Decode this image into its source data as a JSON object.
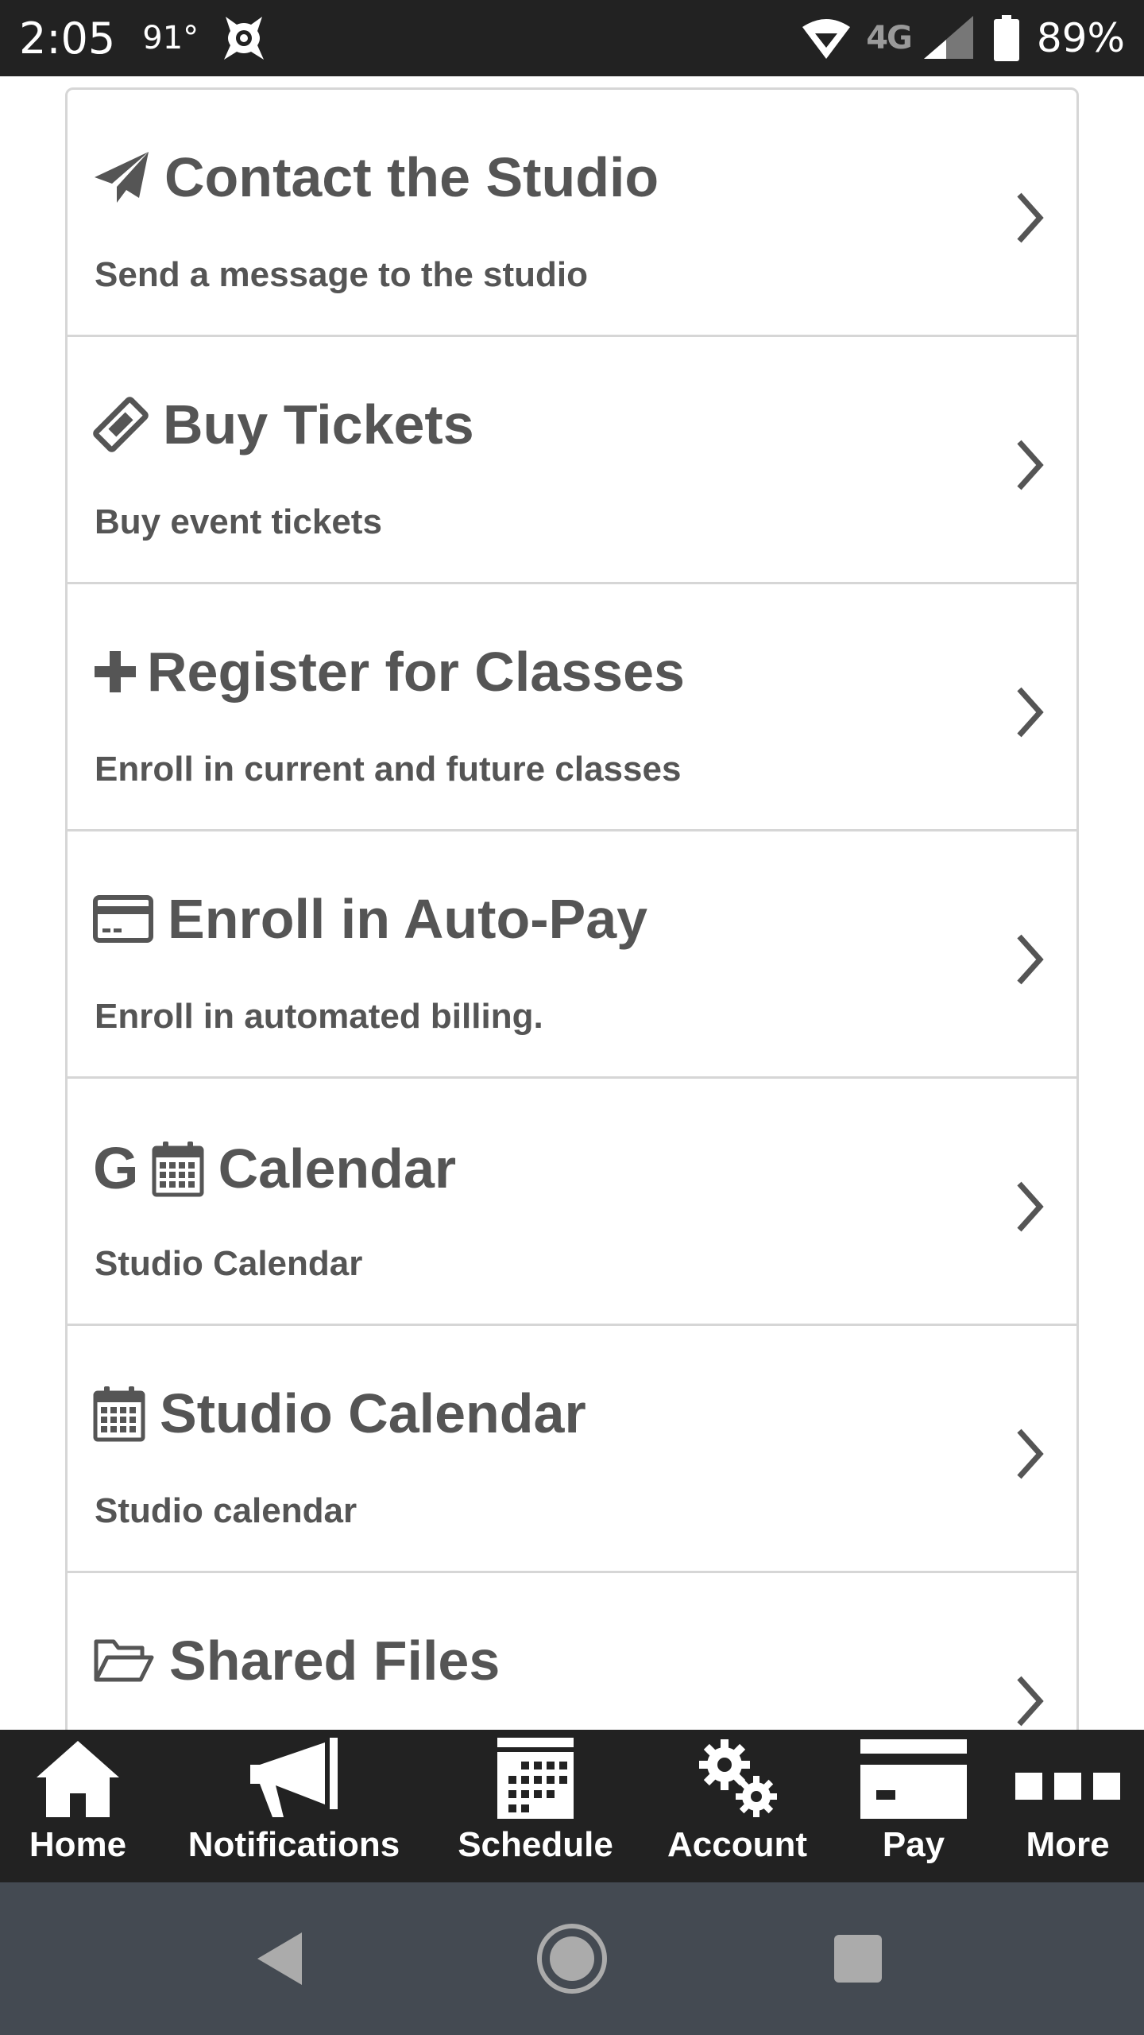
{
  "status_bar": {
    "time": "2:05",
    "temperature": "91°",
    "network": "4G",
    "battery": "89%"
  },
  "menu": [
    {
      "icon": "paper-plane-icon",
      "title": "Contact the Studio",
      "subtitle": "Send a message to the studio"
    },
    {
      "icon": "ticket-icon",
      "title": "Buy Tickets",
      "subtitle": "Buy event tickets"
    },
    {
      "icon": "plus-icon",
      "title": "Register for Classes",
      "subtitle": "Enroll in current and future classes"
    },
    {
      "icon": "credit-card-icon",
      "title": "Enroll in Auto-Pay",
      "subtitle": "Enroll in automated billing."
    },
    {
      "icon": "google-calendar-icon",
      "prefix": "G",
      "title": "Calendar",
      "subtitle": "Studio Calendar"
    },
    {
      "icon": "calendar-icon",
      "title": "Studio Calendar",
      "subtitle": "Studio calendar"
    },
    {
      "icon": "folder-open-icon",
      "title": "Shared Files",
      "subtitle": ""
    }
  ],
  "bottom_nav": [
    {
      "icon": "home-icon",
      "label": "Home"
    },
    {
      "icon": "megaphone-icon",
      "label": "Notifications"
    },
    {
      "icon": "schedule-icon",
      "label": "Schedule"
    },
    {
      "icon": "gears-icon",
      "label": "Account"
    },
    {
      "icon": "card-icon",
      "label": "Pay"
    },
    {
      "icon": "more-icon",
      "label": "More"
    }
  ],
  "colors": {
    "bar_background": "#222222",
    "text_gray": "#555555",
    "divider": "#d6d6d6",
    "system_nav": "#444a52"
  }
}
